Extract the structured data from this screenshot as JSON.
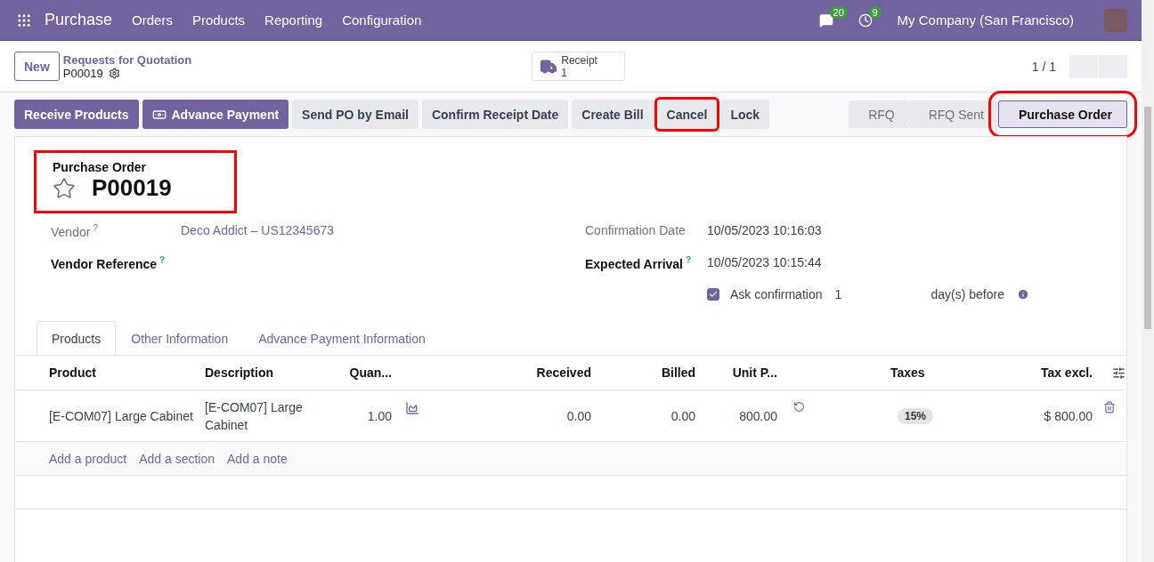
{
  "navbar": {
    "app": "Purchase",
    "menus": [
      "Orders",
      "Products",
      "Reporting",
      "Configuration"
    ],
    "messages_count": "20",
    "activities_count": "9",
    "company": "My Company (San Francisco)"
  },
  "control_panel": {
    "new_button": "New",
    "breadcrumb": "Requests for Quotation",
    "record": "P00019",
    "smart_button": {
      "label": "Receipt",
      "count": "1"
    },
    "pager": "1 / 1"
  },
  "actions": [
    {
      "label": "Receive Products",
      "primary": true,
      "highlighted": false,
      "icon": false
    },
    {
      "label": "Advance Payment",
      "primary": true,
      "highlighted": false,
      "icon": true
    },
    {
      "label": "Send PO by Email",
      "primary": false,
      "highlighted": false,
      "icon": false
    },
    {
      "label": "Confirm Receipt Date",
      "primary": false,
      "highlighted": false,
      "icon": false
    },
    {
      "label": "Create Bill",
      "primary": false,
      "highlighted": false,
      "icon": false
    },
    {
      "label": "Cancel",
      "primary": false,
      "highlighted": true,
      "icon": false
    },
    {
      "label": "Lock",
      "primary": false,
      "highlighted": false,
      "icon": false
    }
  ],
  "stages": [
    {
      "label": "RFQ",
      "selected": false,
      "highlighted": false
    },
    {
      "label": "RFQ Sent",
      "selected": false,
      "highlighted": false
    },
    {
      "label": "Purchase Order",
      "selected": true,
      "highlighted": true
    }
  ],
  "title": {
    "label": "Purchase Order",
    "name": "P00019",
    "starred": false,
    "highlighted": true
  },
  "left_fields": [
    {
      "label": "Vendor",
      "help": "?",
      "value": "Deco Addict – US12345673",
      "bold": false,
      "link": true
    },
    {
      "label": "Vendor Reference",
      "help": "?",
      "bold": true
    }
  ],
  "right_fields": [
    {
      "label": "Confirmation Date",
      "value": "10/05/2023 10:16:03",
      "bold": false
    },
    {
      "label": "Expected Arrival",
      "help": "?",
      "value": "10/05/2023 10:15:44",
      "bold": true
    }
  ],
  "ask_confirmation": {
    "checked": true,
    "label": "Ask confirmation",
    "days": "1",
    "suffix": "day(s) before"
  },
  "tabs": [
    {
      "label": "Products",
      "selected": true
    },
    {
      "label": "Other Information",
      "selected": false
    },
    {
      "label": "Advance Payment Information",
      "selected": false
    }
  ],
  "table": {
    "columns": [
      "Product",
      "Description",
      "Quan...",
      "",
      "Received",
      "Billed",
      "Unit P...",
      "",
      "Taxes",
      "Tax excl."
    ],
    "rows": [
      {
        "product": "[E-COM07] Large Cabinet",
        "description": "[E-COM07] Large Cabinet",
        "quantity": "1.00",
        "received": "0.00",
        "billed": "0.00",
        "unit_price": "800.00",
        "tax": "15%",
        "subtotal": "$ 800.00"
      }
    ],
    "add_links": [
      "Add a product",
      "Add a section",
      "Add a note"
    ]
  }
}
